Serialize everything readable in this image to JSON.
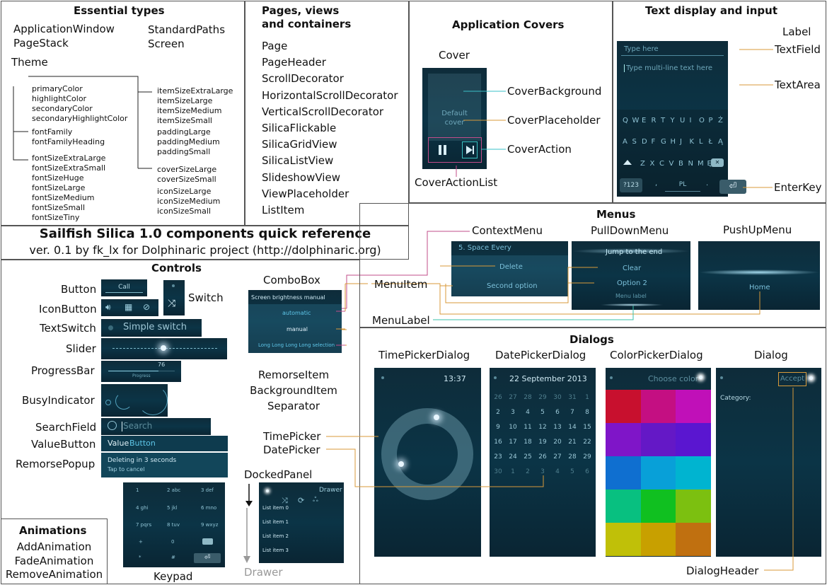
{
  "essential": {
    "title": "Essential types",
    "types": [
      "ApplicationWindow",
      "PageStack",
      "Theme",
      "StandardPaths",
      "Screen"
    ],
    "theme_group1": [
      "primaryColor",
      "highlightColor",
      "secondaryColor",
      "secondaryHighlightColor"
    ],
    "theme_group2": [
      "fontFamily",
      "fontFamilyHeading"
    ],
    "theme_group3": [
      "fontSizeExtraLarge",
      "fontSizeExtraSmall",
      "fontSizeHuge",
      "fontSizeLarge",
      "fontSizeMedium",
      "fontSizeSmall",
      "fontSizeTiny"
    ],
    "theme_group4": [
      "itemSizeExtraLarge",
      "itemSizeLarge",
      "itemSizeMedium",
      "itemSizeSmall"
    ],
    "theme_group5": [
      "paddingLarge",
      "paddingMedium",
      "paddingSmall"
    ],
    "theme_group6": [
      "coverSizeLarge",
      "coverSizeSmall",
      "iconSizeLarge",
      "iconSizeMedium",
      "iconSizeSmall"
    ]
  },
  "pages": {
    "title_line1": "Pages, views",
    "title_line2": "and containers",
    "items": [
      "Page",
      "PageHeader",
      "ScrollDecorator",
      "HorizontalScrollDecorator",
      "VerticalScrollDecorator",
      "SilicaFlickable",
      "SilicaGridView",
      "SilicaListView",
      "SlideshowView",
      "ViewPlaceholder",
      "ListItem"
    ]
  },
  "covers": {
    "title": "Application Covers",
    "cover_label": "Cover",
    "cover_text_line1": "Default",
    "cover_text_line2": "cover",
    "labels": [
      "CoverBackground",
      "CoverPlaceholder",
      "CoverAction",
      "CoverActionList"
    ]
  },
  "text_input": {
    "title": "Text display and input",
    "label_item": "Label",
    "textfield_placeholder": "Type here",
    "textarea_placeholder": "Type multi-line text here",
    "labels": [
      "TextField",
      "TextArea",
      "EnterKey"
    ],
    "keyboard_row1": [
      "Q",
      "W",
      "E",
      "R",
      "T",
      "Y",
      "U",
      "I",
      "O",
      "P",
      "Ż"
    ],
    "keyboard_row2": [
      "A",
      "S",
      "D",
      "F",
      "G",
      "H",
      "J",
      "K",
      "L",
      "Ł",
      "Ą"
    ],
    "keyboard_row3": [
      "Z",
      "X",
      "C",
      "V",
      "B",
      "N",
      "M",
      "Ę"
    ],
    "key_symbols": "?123",
    "key_comma": ",",
    "key_space": "PL",
    "key_period": "."
  },
  "caption": {
    "title": "Sailfish Silica 1.0 components quick reference",
    "subtitle": "ver. 0.1 by fk_lx for Dolphinaric project (http://dolphinaric.org)"
  },
  "menus": {
    "title": "Menus",
    "headers": [
      "ContextMenu",
      "PullDownMenu",
      "PushUpMenu"
    ],
    "context_header": "5. Space Every",
    "context_items": [
      "Delete",
      "Second option"
    ],
    "pulldown_items": [
      "Jump to the end",
      "Clear",
      "Option 2"
    ],
    "pulldown_label": "Menu label",
    "pushup_item": "Home",
    "menuitem_label": "MenuItem",
    "menulabel_label": "MenuLabel"
  },
  "controls": {
    "title": "Controls",
    "labels": [
      "Button",
      "IconButton",
      "TextSwitch",
      "Slider",
      "ProgressBar",
      "BusyIndicator",
      "SearchField",
      "ValueButton",
      "RemorsePopup"
    ],
    "switch_label": "Switch",
    "button_text": "Call",
    "textswitch_text": "Simple switch",
    "progress_value": "76",
    "progress_label": "Progress",
    "search_placeholder": "Search",
    "value_button_label": "Value",
    "value_button_value": "Button",
    "remorse_line1": "Deleting in 3 seconds",
    "remorse_line2": "Tap to cancel",
    "combobox_label": "ComboBox",
    "combobox_header": "Screen brightness manual",
    "combobox_items": [
      "automatic",
      "manual",
      "Long Long Long Long selection"
    ],
    "other_items": [
      "RemorseItem",
      "BackgroundItem",
      "Separator"
    ],
    "keypad_label": "Keypad",
    "keypad_keys": [
      "1",
      "2 abc",
      "3 def",
      "4 ghi",
      "5 jkl",
      "6 mno",
      "7 pqrs",
      "8 tuv",
      "9 wxyz",
      "+",
      "0",
      "*",
      "#"
    ],
    "docked_label": "DockedPanel",
    "drawer_label": "Drawer",
    "drawer_title": "Drawer",
    "drawer_items": [
      "List item 0",
      "List item 1",
      "List item 2",
      "List item 3"
    ]
  },
  "animations": {
    "title": "Animations",
    "items": [
      "AddAnimation",
      "FadeAnimation",
      "RemoveAnimation"
    ]
  },
  "dialogs": {
    "title": "Dialogs",
    "headers": [
      "TimePickerDialog",
      "DatePickerDialog",
      "ColorPickerDialog",
      "Dialog"
    ],
    "time_value": "13:37",
    "date_value": "22 September 2013",
    "color_title": "Choose color",
    "dialog_accept": "Accept",
    "dialog_category": "Category:",
    "timepicker_label": "TimePicker",
    "datepicker_label": "DatePicker",
    "dialogheader_label": "DialogHeader",
    "calendar": [
      "26",
      "27",
      "28",
      "29",
      "30",
      "31",
      "1",
      "2",
      "3",
      "4",
      "5",
      "6",
      "7",
      "8",
      "9",
      "10",
      "11",
      "12",
      "13",
      "14",
      "15",
      "16",
      "17",
      "18",
      "19",
      "20",
      "21",
      "22",
      "23",
      "24",
      "25",
      "26",
      "27",
      "28",
      "29",
      "30",
      "1",
      "2",
      "3",
      "4",
      "5",
      "6"
    ],
    "colors": [
      "#c8102e",
      "#c40f82",
      "#c010b8",
      "#7f15c8",
      "#6418c6",
      "#5a16d0",
      "#0f6fd0",
      "#08a0d8",
      "#00b4d0",
      "#08c080",
      "#10c020",
      "#7cc010",
      "#c0c008",
      "#c8a000",
      "#c07010"
    ]
  }
}
